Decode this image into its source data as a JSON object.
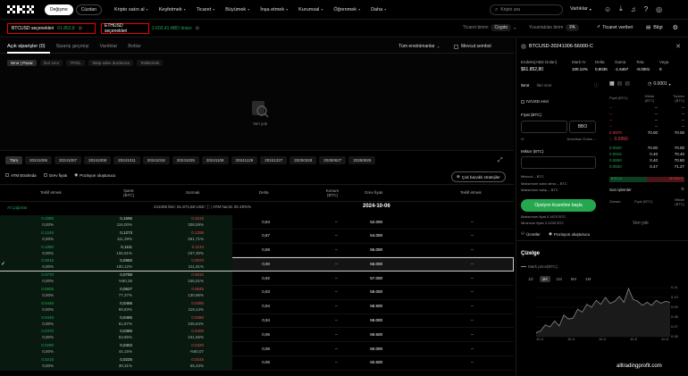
{
  "nav": {
    "logo": "OKX",
    "exchange_tab": "Değişme",
    "wallet_tab": "Cüzdan",
    "menu": [
      "Kripto satın al",
      "Keşfetmek",
      "Ticaret",
      "Büyümek",
      "İnşa etmek",
      "Kurumsal",
      "Öğrenmek",
      "Daha"
    ],
    "search_placeholder": "Kripto ara",
    "assets": "Varlıklar"
  },
  "markets": [
    {
      "name": "BTCUSD seçenekleri",
      "price": "61.852,8"
    },
    {
      "name": "ETHUSD seçenekleri",
      "price": "2.602,41 ABD doları"
    }
  ],
  "trade_unit": {
    "label": "Ticaret birimi",
    "value": "Crypto"
  },
  "rounding": {
    "label": "Yuvarlatılan birim",
    "value": "PA"
  },
  "trading_data": "Ticaret verileri",
  "info": "Bilgi",
  "orders": {
    "tabs": [
      "Açık siparişler (0)",
      "Sipariş geçmişi",
      "Varlıklar",
      "Botlar"
    ],
    "instrument_filter": "Tüm enstrümanlar",
    "current_symbol": "Mevcut sembol",
    "subtabs": [
      "Sınır | Pazar",
      "İleri sınır",
      "TP/SL",
      "Takip eden durdurma",
      "Tetiklemek"
    ],
    "empty": "Veri yok"
  },
  "expiries": [
    "Tüm",
    "20241006",
    "20241007",
    "20241008",
    "20241011",
    "20241018",
    "20241025",
    "20241108",
    "20241129",
    "20241227",
    "20250328",
    "20250627",
    "20250926"
  ],
  "chain_options": {
    "atm": "ATM Etrafında",
    "price": "Grev fiyatı",
    "position": "Pozisyon oluşturucu",
    "multi_leg": "Çok bacaklı stratejiler"
  },
  "chain": {
    "headers": [
      "Teklif etmek",
      "İşaret (BTC)",
      "Sormak",
      "Delta",
      "Konum (BTC)",
      "Grev fiyatı",
      "Teklif etmek"
    ],
    "calls_label": "Al Çağırılar",
    "date": "2024-10-06",
    "banner_left": "241006 İleri: 61.874,58 USD",
    "banner_right": "ATM hacmi 29.19%%",
    "rows": [
      {
        "bid": "0.1586",
        "bid_iv": "0,00%",
        "mark": "0,1596",
        "mark_iv": "116,00%",
        "ask": "0.1615",
        "ask_iv": "308,59%",
        "delta": "0,84",
        "pos": "--",
        "strike": "52.000",
        "right": "--"
      },
      {
        "bid": "0.1240",
        "bid_iv": "0,00%",
        "mark": "0,1273",
        "mark_iv": "111,39%",
        "ask": "0.1299",
        "ask_iv": "261,71%",
        "delta": "0,87",
        "pos": "--",
        "strike": "54.000",
        "right": "--"
      },
      {
        "bid": "0.1080",
        "bid_iv": "0,00%",
        "mark": "0,1111",
        "mark_iv": "106,91%",
        "ask": "0.1134",
        "ask_iv": "237,30%",
        "delta": "0,89",
        "pos": "--",
        "strike": "55.000",
        "right": "--"
      },
      {
        "bid": "0.0915",
        "bid_iv": "0,00%",
        "mark": "0,0950",
        "mark_iv": "100,12%",
        "ask": "0.0970",
        "ask_iv": "211,91%",
        "delta": "0,90",
        "pos": "--",
        "strike": "56.000",
        "right": "--"
      },
      {
        "bid": "0.0770",
        "bid_iv": "0,00%",
        "mark": "0,0788",
        "mark_iv": "%90,36",
        "ask": "0.0810",
        "ask_iv": "166,01%",
        "delta": "0,92",
        "pos": "--",
        "strike": "57.000",
        "right": "--"
      },
      {
        "bid": "0.0605",
        "bid_iv": "0,00%",
        "mark": "0,0627",
        "mark_iv": "77,37%",
        "ask": "0.0645",
        "ask_iv": "130,86%",
        "delta": "0,93",
        "pos": "--",
        "strike": "58.000",
        "right": "--"
      },
      {
        "bid": "0.0445",
        "bid_iv": "0,00%",
        "mark": "0,0466",
        "mark_iv": "69,83%",
        "ask": "0.0485",
        "ask_iv": "119,14%",
        "delta": "0,94",
        "pos": "--",
        "strike": "58.500",
        "right": "--"
      },
      {
        "bid": "0.0445",
        "bid_iv": "0,00%",
        "mark": "0,0465",
        "mark_iv": "61,87%",
        "ask": "0.0480",
        "ask_iv": "106,64%",
        "delta": "0,94",
        "pos": "--",
        "strike": "59.000",
        "right": "--"
      },
      {
        "bid": "0.0370",
        "bid_iv": "0,00%",
        "mark": "0,0385",
        "mark_iv": "53,86%",
        "ask": "0.0400",
        "ask_iv": "101,56%",
        "delta": "0,95",
        "pos": "--",
        "strike": "59.500",
        "right": "--"
      },
      {
        "bid": "0.0290",
        "bid_iv": "0,00%",
        "mark": "0,0304",
        "mark_iv": "44,15%",
        "ask": "0.0320",
        "ask_iv": "%80,07",
        "delta": "0,95",
        "pos": "--",
        "strike": "60.000",
        "right": "--"
      },
      {
        "bid": "0.0215",
        "bid_iv": "0,00%",
        "mark": "0,0225",
        "mark_iv": "39,31%",
        "ask": "0.0245",
        "ask_iv": "65,43%",
        "delta": "0,95",
        "pos": "--",
        "strike": "60.500",
        "right": "--"
      }
    ]
  },
  "panel": {
    "instrument": "BTCUSD-20241006-56000-C",
    "index_label": "Endeks(ABD Doları)",
    "index_value": "$61.852,80",
    "stats": [
      {
        "label": "Mark IV",
        "value": "100.12%"
      },
      {
        "label": "Delta",
        "value": "0,9035"
      },
      {
        "label": "Gama",
        "value": "-1.6467"
      },
      {
        "label": "Teta",
        "value": "-0.0001"
      },
      {
        "label": "Vega",
        "value": "0"
      }
    ],
    "order_tabs": [
      "Sınır",
      "İleri sınır"
    ],
    "iv_usd": "IV/USD emri",
    "price_label": "Fiyat (BTC)",
    "bbo": "BBO",
    "iv_label": "IV",
    "amerikan": "Amerikan Doları --",
    "qty_label": "Miktar (BTC)",
    "available": "Mevcut -- BTC",
    "max_buy": "Maksimum satın alma -- BTC",
    "max_sell": "Maksimum satış -- BTC",
    "trade_button": "Opsiyon ticaretine başla",
    "max_cost": "Maksimum fiyat 0.1670 BTC",
    "min_price": "Minimum fiyatı 0.0230 BTC",
    "fees": "Ücretler",
    "position_builder": "Pozisyon oluşturucu"
  },
  "orderbook": {
    "tick": "0.0001",
    "headers": [
      "Fiyat (BTC)",
      "Miktar (BTC)",
      "Toplam (BTC)"
    ],
    "asks": [
      {
        "price": "--",
        "qty": "--",
        "total": "--"
      },
      {
        "price": "--",
        "qty": "--",
        "total": "--"
      },
      {
        "price": "--",
        "qty": "--",
        "total": "--"
      },
      {
        "price": "--",
        "qty": "--",
        "total": "--"
      },
      {
        "price": "0.0970",
        "qty": "70.00",
        "total": "70.00"
      }
    ],
    "mid": "0.0950",
    "bids": [
      {
        "price": "0.0920",
        "qty": "70.00",
        "total": "70.00"
      },
      {
        "price": "0.0915",
        "qty": "0.40",
        "total": "70.40"
      },
      {
        "price": "0.0860",
        "qty": "0.40",
        "total": "70.80"
      },
      {
        "price": "0.0500",
        "qty": "0.47",
        "total": "71.27"
      }
    ],
    "ratio_left": "B 50.24",
    "ratio_right": "49.76% S",
    "trades_tab": "Son işlemler",
    "trade_headers": [
      "Zaman",
      "Fiyat (BTC)",
      "Miktar (BTC)"
    ],
    "empty": "Veri yok"
  },
  "mini_chart": {
    "title": "Çizelge",
    "series_label": "Mark price(BTC)",
    "ranges": [
      "1D",
      "1H",
      "1M",
      "5M",
      "4M"
    ],
    "selected_range": "1H",
    "x_labels": [
      "10-3",
      "10-4",
      "10-4",
      "10-5",
      "10-5"
    ],
    "y_labels": [
      "0.11",
      "0.10",
      "0.09",
      "0.08",
      "0.07",
      "0.06"
    ],
    "values": [
      0.064,
      0.066,
      0.072,
      0.07,
      0.076,
      0.071,
      0.082,
      0.078,
      0.079,
      0.088,
      0.085,
      0.093,
      0.09,
      0.097,
      0.093,
      0.1,
      0.094,
      0.096,
      0.101,
      0.095,
      0.109,
      0.098,
      0.096,
      0.092,
      0.095,
      0.092,
      0.097,
      0.094,
      0.096,
      0.095
    ]
  },
  "watermark": "alltradingprofit.com"
}
